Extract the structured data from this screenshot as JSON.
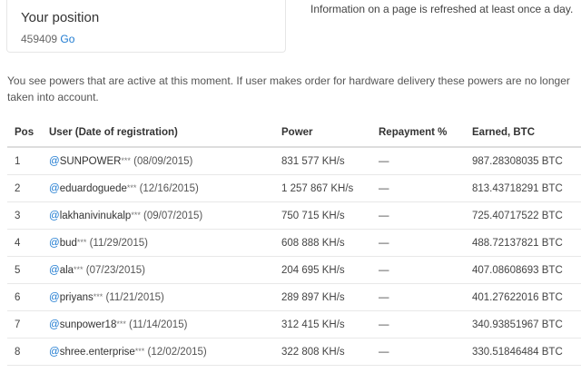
{
  "position": {
    "title": "Your position",
    "value": "459409",
    "go_label": "Go"
  },
  "refresh_note": "Information on a page is refreshed at least once a day.",
  "notice": "You see powers that are active at this moment. If user makes order for hardware delivery these powers are no longer taken into account.",
  "table": {
    "headers": {
      "pos": "Pos",
      "user": "User (Date of registration)",
      "power": "Power",
      "repayment": "Repayment %",
      "earned": "Earned, BTC"
    },
    "rows": [
      {
        "pos": "1",
        "at": "@",
        "user": "SUNPOWER",
        "stars": "***",
        "date": " (08/09/2015)",
        "power": "831 577 KH/s",
        "repayment": "—",
        "earned": "987.28308035 BTC"
      },
      {
        "pos": "2",
        "at": "@",
        "user": "eduardoguede",
        "stars": "***",
        "date": " (12/16/2015)",
        "power": "1 257 867 KH/s",
        "repayment": "—",
        "earned": "813.43718291 BTC"
      },
      {
        "pos": "3",
        "at": "@",
        "user": "lakhanivinukalp",
        "stars": "***",
        "date": " (09/07/2015)",
        "power": "750 715 KH/s",
        "repayment": "—",
        "earned": "725.40717522 BTC"
      },
      {
        "pos": "4",
        "at": "@",
        "user": "bud",
        "stars": "***",
        "date": " (11/29/2015)",
        "power": "608 888 KH/s",
        "repayment": "—",
        "earned": "488.72137821 BTC"
      },
      {
        "pos": "5",
        "at": "@",
        "user": "ala",
        "stars": "***",
        "date": " (07/23/2015)",
        "power": "204 695 KH/s",
        "repayment": "—",
        "earned": "407.08608693 BTC"
      },
      {
        "pos": "6",
        "at": "@",
        "user": "priyans",
        "stars": "***",
        "date": " (11/21/2015)",
        "power": "289 897 KH/s",
        "repayment": "—",
        "earned": "401.27622016 BTC"
      },
      {
        "pos": "7",
        "at": "@",
        "user": "sunpower18",
        "stars": "***",
        "date": " (11/14/2015)",
        "power": "312 415 KH/s",
        "repayment": "—",
        "earned": "340.93851967 BTC"
      },
      {
        "pos": "8",
        "at": "@",
        "user": "shree.enterprise",
        "stars": "***",
        "date": " (12/02/2015)",
        "power": "322 808 KH/s",
        "repayment": "—",
        "earned": "330.51846484 BTC"
      }
    ]
  },
  "colors": {
    "link": "#1f7bd1",
    "text": "#333333",
    "border": "#dddddd"
  }
}
